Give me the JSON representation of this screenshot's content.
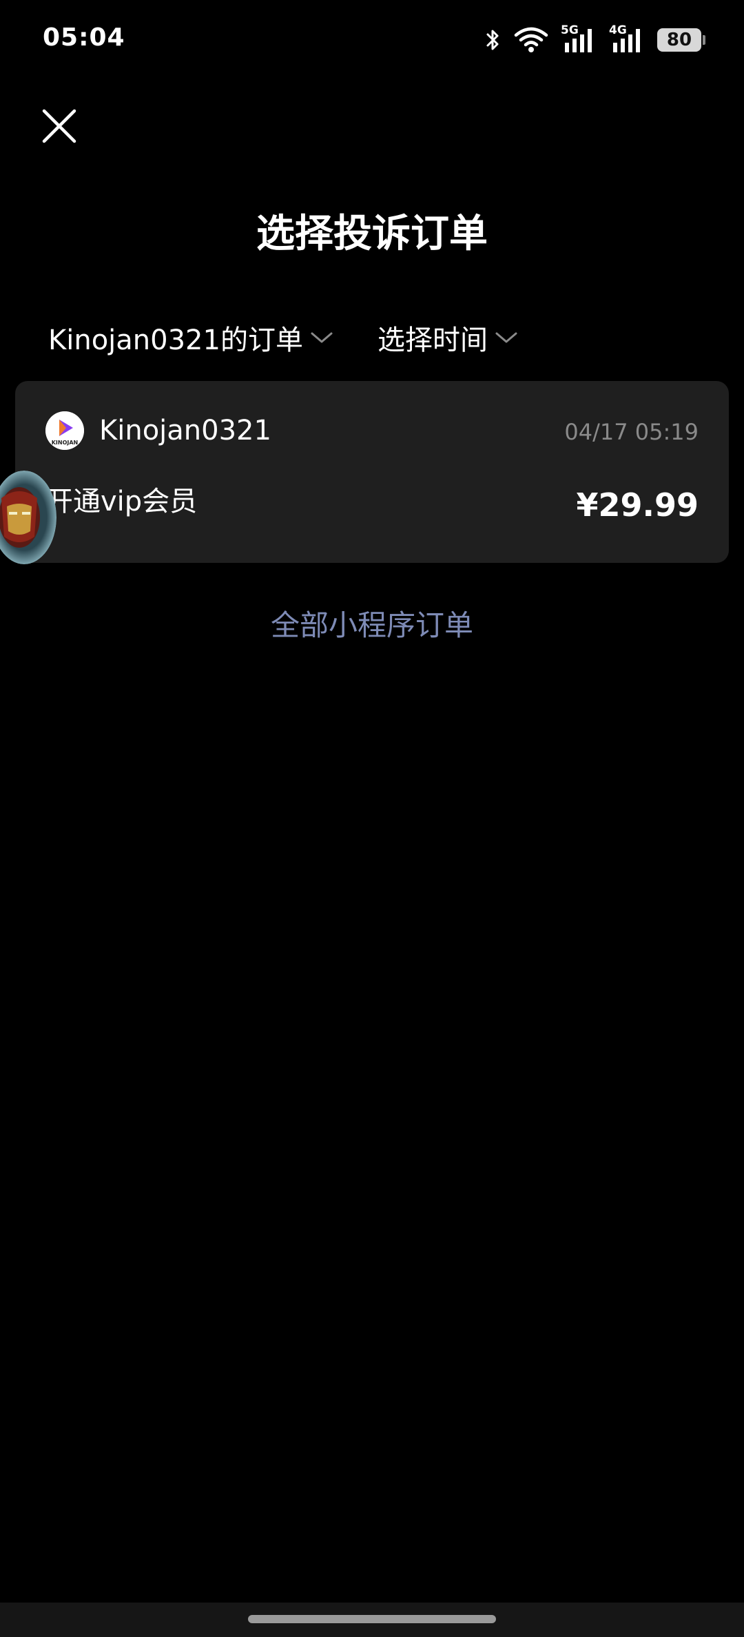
{
  "status_bar": {
    "time": "05:04",
    "network_1": "5G",
    "network_2": "4G",
    "battery": "80"
  },
  "header": {
    "close_icon": "close-icon",
    "title": "选择投诉订单"
  },
  "filters": {
    "account_label": "Kinojan0321的订单",
    "time_label": "选择时间",
    "chevron_icon": "chevron-down-icon"
  },
  "order": {
    "merchant_name": "Kinojan0321",
    "merchant_logo_text": "KINOJAN",
    "time": "04/17 05:19",
    "description": "开通vip会员",
    "price": "¥29.99"
  },
  "footer_link": {
    "label": "全部小程序订单"
  },
  "colors": {
    "background": "#000000",
    "card": "#1f1f1f",
    "link": "#7e8bb6",
    "muted": "#8a8a8a",
    "logo_accent": "#8a3cf0"
  }
}
